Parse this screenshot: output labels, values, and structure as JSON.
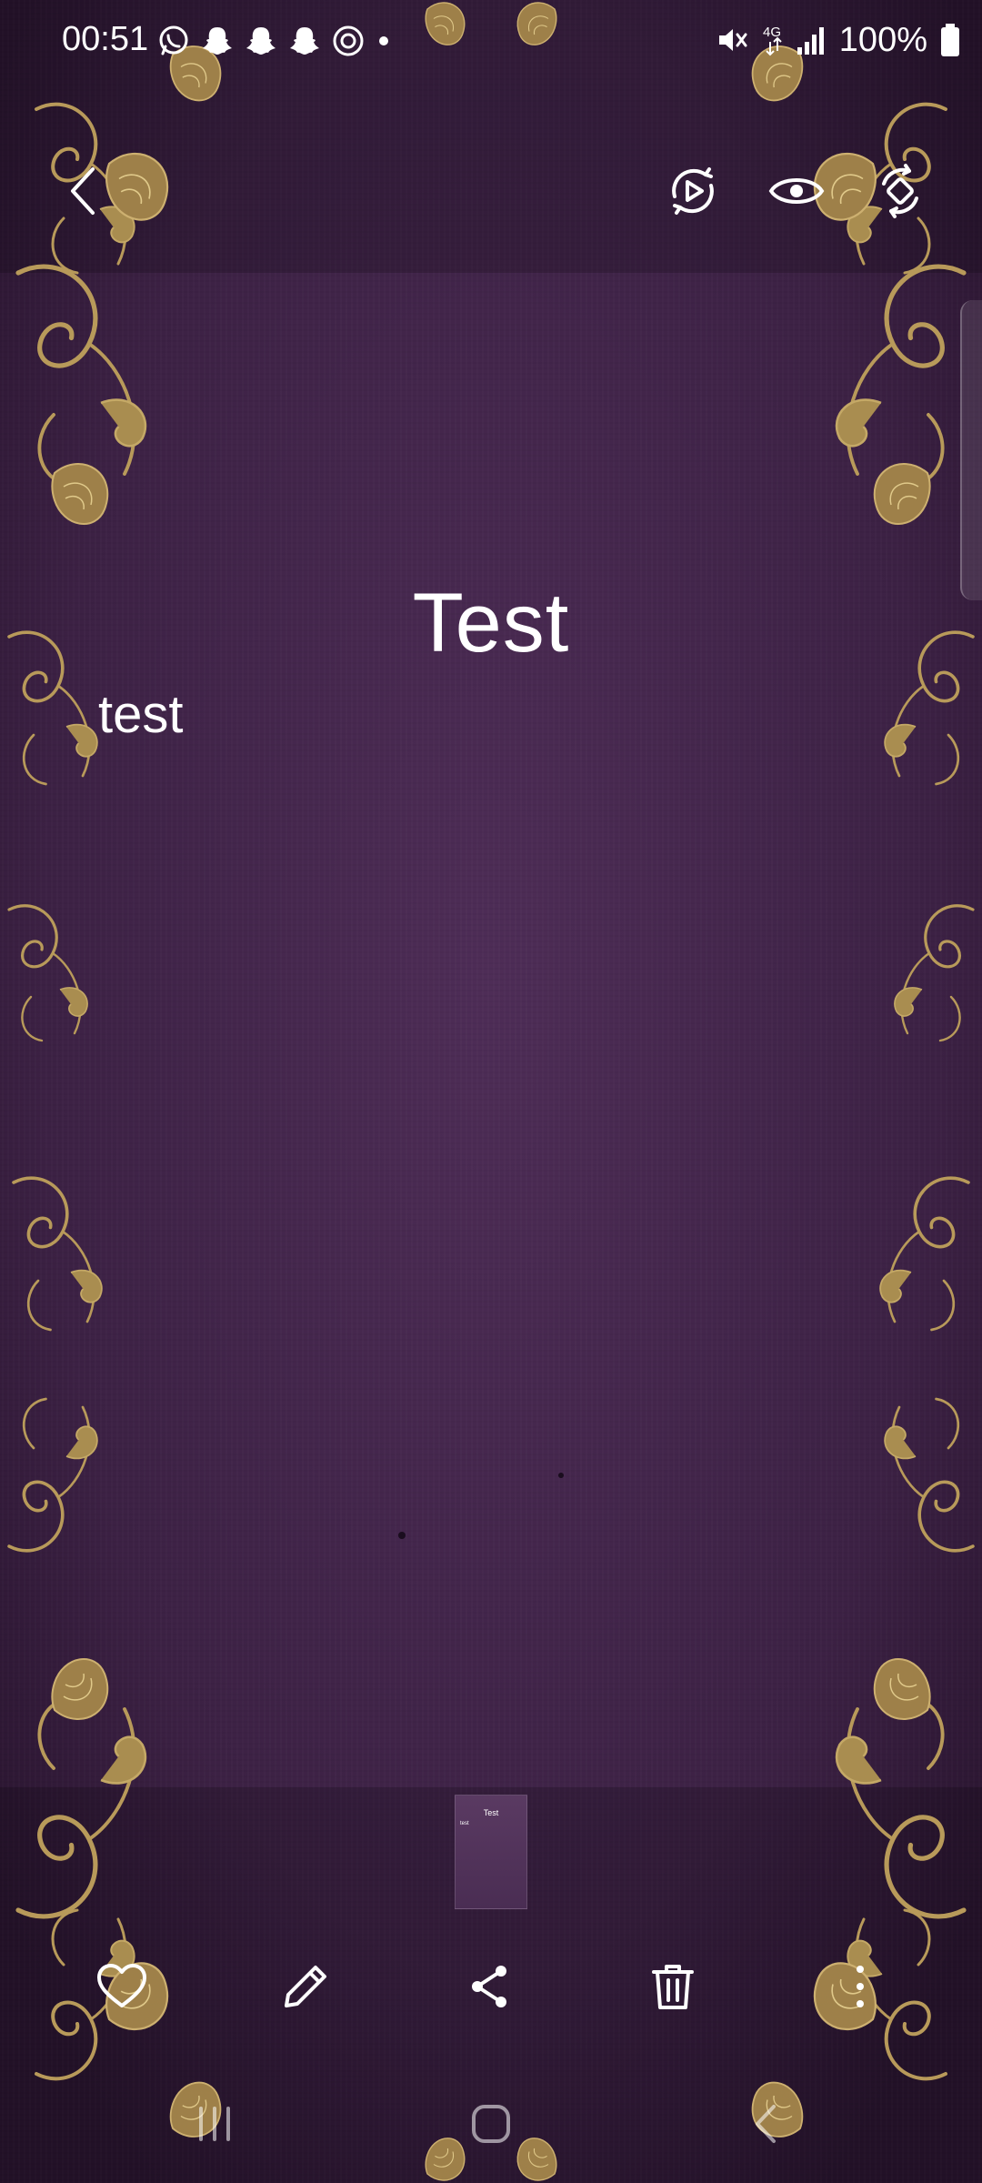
{
  "status_bar": {
    "time": "00:51",
    "notification_icons": [
      "whatsapp-icon",
      "snapchat-icon",
      "snapchat-icon",
      "snapchat-icon",
      "threads-icon",
      "dot-icon"
    ],
    "network_label": "4G",
    "battery": "100%"
  },
  "toolbar": {
    "back_icon": "back-chevron-icon",
    "actions": [
      "remaster-play-icon",
      "eye-icon",
      "rotate-icon"
    ]
  },
  "note": {
    "title": "Test",
    "body": "test"
  },
  "thumbnail": {
    "title": "Test",
    "body": "test"
  },
  "bottom_actions": [
    "heart-icon",
    "pencil-icon",
    "share-icon",
    "trash-icon",
    "more-vertical-icon"
  ],
  "nav_bar": [
    "recents-icon",
    "home-icon",
    "back-icon"
  ],
  "colors": {
    "background": "#3a1f42",
    "ornament": "#b89a5a",
    "text": "#ffffff"
  }
}
